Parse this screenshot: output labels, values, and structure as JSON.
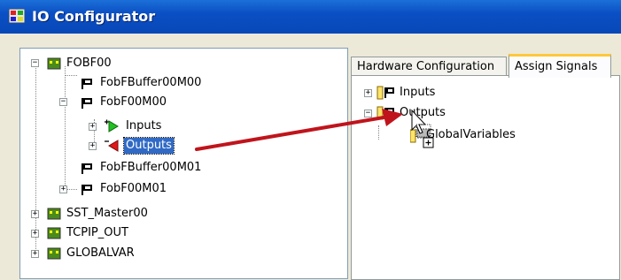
{
  "window": {
    "title": "IO Configurator"
  },
  "tree": {
    "fobf00": "FOBF00",
    "fobfbuffer00m00": "FobFBuffer00M00",
    "fobf00m00": "FobF00M00",
    "inputs": "Inputs",
    "outputs": "Outputs",
    "fobfbuffer00m01": "FobFBuffer00M01",
    "fobf00m01": "FobF00M01",
    "sst_master00": "SST_Master00",
    "tcpip_out": "TCPIP_OUT",
    "globalvar": "GLOBALVAR"
  },
  "tabs": {
    "hardware": "Hardware Configuration",
    "assign": "Assign Signals"
  },
  "signals": {
    "inputs": "Inputs",
    "outputs": "Outputs",
    "globalvariables": "GlobalVariables"
  },
  "colors": {
    "arrow": "#c0141c",
    "selection": "#316ac5",
    "titlebar": "#0a4fc4"
  }
}
